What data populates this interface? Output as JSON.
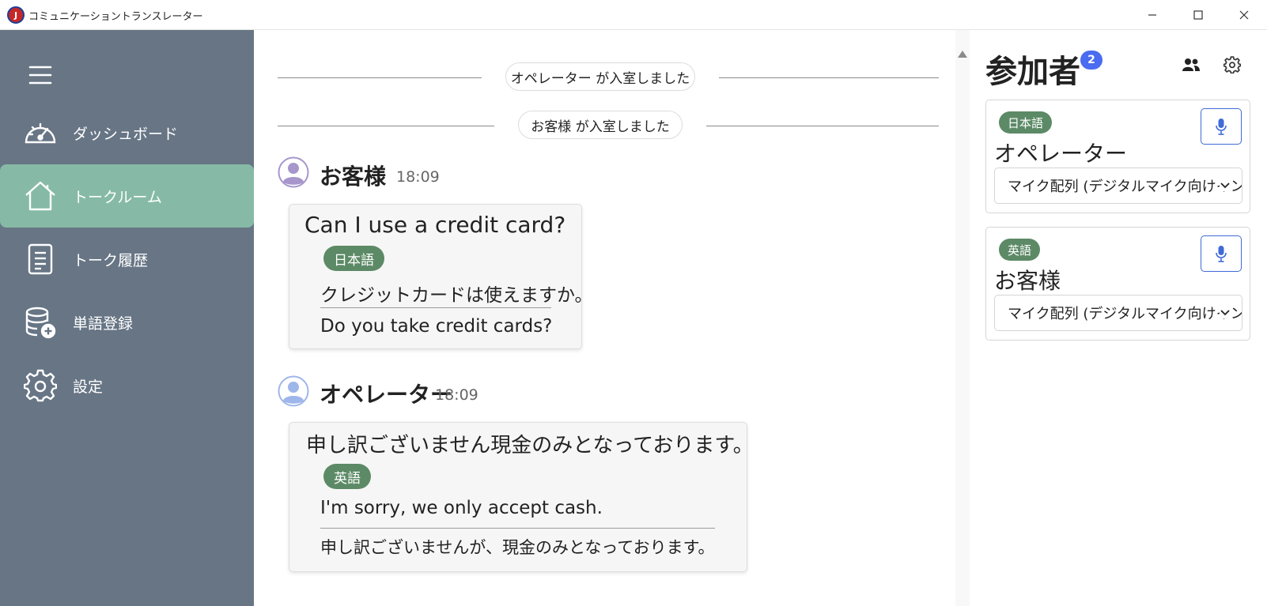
{
  "window": {
    "title": "コミュニケーショントランスレーター",
    "logo_text": "J"
  },
  "sidebar": {
    "items": [
      {
        "label": "ダッシュボード",
        "icon": "dashboard-icon"
      },
      {
        "label": "トークルーム",
        "icon": "home-icon",
        "active": true
      },
      {
        "label": "トーク履歴",
        "icon": "document-icon"
      },
      {
        "label": "単語登録",
        "icon": "database-add-icon"
      },
      {
        "label": "設定",
        "icon": "gear-icon"
      }
    ]
  },
  "chat": {
    "system_messages": [
      "オペレーター が入室しました",
      "お客様 が入室しました"
    ],
    "messages": [
      {
        "speaker": "お客様",
        "time": "18:09",
        "text": "Can I use a credit card?",
        "target_language": "日本語",
        "translation": "クレジットカードは使えますか。",
        "back_translation": "Do you take credit cards?"
      },
      {
        "speaker": "オペレーター",
        "time": "18:09",
        "text": "申し訳ございません現金のみとなっております。",
        "target_language": "英語",
        "translation": "I'm sorry, we only accept cash.",
        "back_translation": "申し訳ございませんが、現金のみとなっております。"
      }
    ]
  },
  "participants": {
    "title": "参加者",
    "count": "2",
    "list": [
      {
        "language": "日本語",
        "name": "オペレーター",
        "mic_device": "マイク配列 (デジタルマイク向けインテル® スマート・サウンド・テクノロジー)"
      },
      {
        "language": "英語",
        "name": "お客様",
        "mic_device": "マイク配列 (デジタルマイク向けインテル® スマート・サウンド・テクノロジー)"
      }
    ]
  },
  "colors": {
    "sidebar_bg": "#677585",
    "sidebar_active": "#86baa6",
    "lang_badge": "#5c8a66",
    "count_badge": "#4a6cf0",
    "mic_accent": "#3f6ad8"
  }
}
